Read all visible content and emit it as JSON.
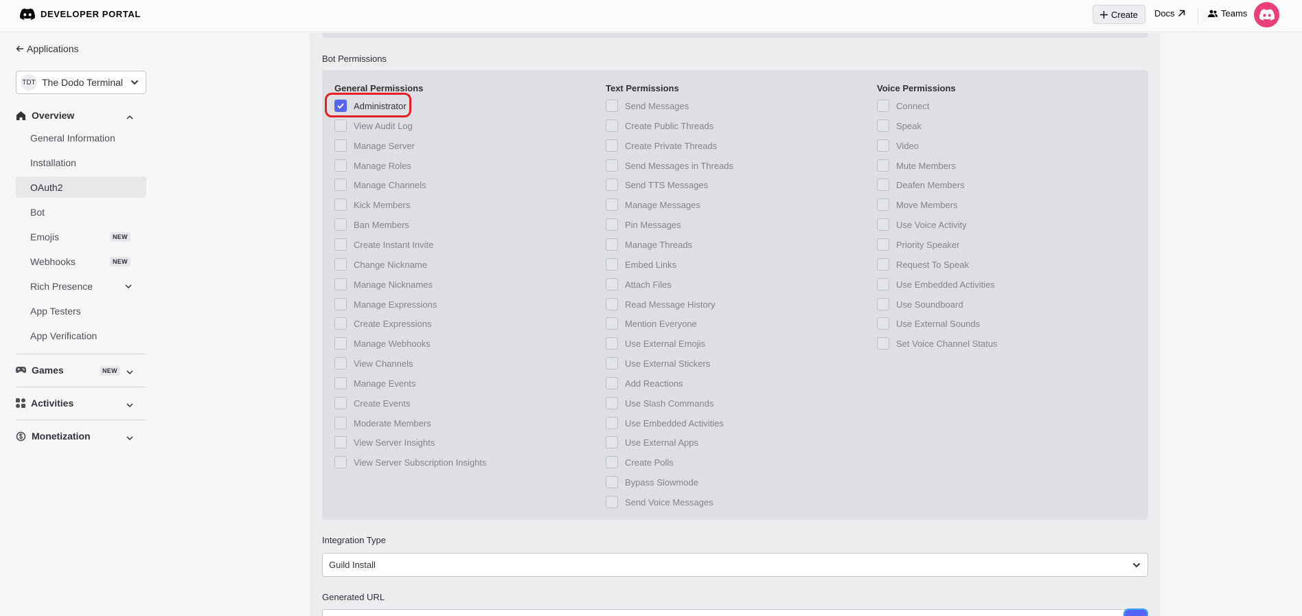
{
  "header": {
    "logo_text": "DEVELOPER PORTAL",
    "create_label": "Create",
    "docs_label": "Docs",
    "teams_label": "Teams"
  },
  "sidebar": {
    "back_label": "Applications",
    "app": {
      "initials": "TDT",
      "name": "The Dodo Terminal"
    },
    "overview_label": "Overview",
    "items": [
      {
        "label": "General Information"
      },
      {
        "label": "Installation"
      },
      {
        "label": "OAuth2"
      },
      {
        "label": "Bot"
      },
      {
        "label": "Emojis",
        "badge": "NEW"
      },
      {
        "label": "Webhooks",
        "badge": "NEW"
      },
      {
        "label": "Rich Presence"
      },
      {
        "label": "App Testers"
      },
      {
        "label": "App Verification"
      }
    ],
    "games_label": "Games",
    "games_badge": "NEW",
    "activities_label": "Activities",
    "monetization_label": "Monetization"
  },
  "main": {
    "bot_permissions_title": "Bot Permissions",
    "columns": [
      {
        "title": "General Permissions",
        "items": [
          {
            "label": "Administrator",
            "checked": true
          },
          {
            "label": "View Audit Log",
            "checked": false
          },
          {
            "label": "Manage Server",
            "checked": false
          },
          {
            "label": "Manage Roles",
            "checked": false
          },
          {
            "label": "Manage Channels",
            "checked": false
          },
          {
            "label": "Kick Members",
            "checked": false
          },
          {
            "label": "Ban Members",
            "checked": false
          },
          {
            "label": "Create Instant Invite",
            "checked": false
          },
          {
            "label": "Change Nickname",
            "checked": false
          },
          {
            "label": "Manage Nicknames",
            "checked": false
          },
          {
            "label": "Manage Expressions",
            "checked": false
          },
          {
            "label": "Create Expressions",
            "checked": false
          },
          {
            "label": "Manage Webhooks",
            "checked": false
          },
          {
            "label": "View Channels",
            "checked": false
          },
          {
            "label": "Manage Events",
            "checked": false
          },
          {
            "label": "Create Events",
            "checked": false
          },
          {
            "label": "Moderate Members",
            "checked": false
          },
          {
            "label": "View Server Insights",
            "checked": false
          },
          {
            "label": "View Server Subscription Insights",
            "checked": false
          }
        ]
      },
      {
        "title": "Text Permissions",
        "items": [
          {
            "label": "Send Messages",
            "checked": false
          },
          {
            "label": "Create Public Threads",
            "checked": false
          },
          {
            "label": "Create Private Threads",
            "checked": false
          },
          {
            "label": "Send Messages in Threads",
            "checked": false
          },
          {
            "label": "Send TTS Messages",
            "checked": false
          },
          {
            "label": "Manage Messages",
            "checked": false
          },
          {
            "label": "Pin Messages",
            "checked": false
          },
          {
            "label": "Manage Threads",
            "checked": false
          },
          {
            "label": "Embed Links",
            "checked": false
          },
          {
            "label": "Attach Files",
            "checked": false
          },
          {
            "label": "Read Message History",
            "checked": false
          },
          {
            "label": "Mention Everyone",
            "checked": false
          },
          {
            "label": "Use External Emojis",
            "checked": false
          },
          {
            "label": "Use External Stickers",
            "checked": false
          },
          {
            "label": "Add Reactions",
            "checked": false
          },
          {
            "label": "Use Slash Commands",
            "checked": false
          },
          {
            "label": "Use Embedded Activities",
            "checked": false
          },
          {
            "label": "Use External Apps",
            "checked": false
          },
          {
            "label": "Create Polls",
            "checked": false
          },
          {
            "label": "Bypass Slowmode",
            "checked": false
          },
          {
            "label": "Send Voice Messages",
            "checked": false
          }
        ]
      },
      {
        "title": "Voice Permissions",
        "items": [
          {
            "label": "Connect",
            "checked": false
          },
          {
            "label": "Speak",
            "checked": false
          },
          {
            "label": "Video",
            "checked": false
          },
          {
            "label": "Mute Members",
            "checked": false
          },
          {
            "label": "Deafen Members",
            "checked": false
          },
          {
            "label": "Move Members",
            "checked": false
          },
          {
            "label": "Use Voice Activity",
            "checked": false
          },
          {
            "label": "Priority Speaker",
            "checked": false
          },
          {
            "label": "Request To Speak",
            "checked": false
          },
          {
            "label": "Use Embedded Activities",
            "checked": false
          },
          {
            "label": "Use Soundboard",
            "checked": false
          },
          {
            "label": "Use External Sounds",
            "checked": false
          },
          {
            "label": "Set Voice Channel Status",
            "checked": false
          }
        ]
      }
    ],
    "integration_type_label": "Integration Type",
    "integration_type_value": "Guild Install",
    "generated_url_label": "Generated URL"
  },
  "colors": {
    "accent": "#5865f2",
    "avatar": "#e9407a",
    "highlight": "#e21e26"
  }
}
